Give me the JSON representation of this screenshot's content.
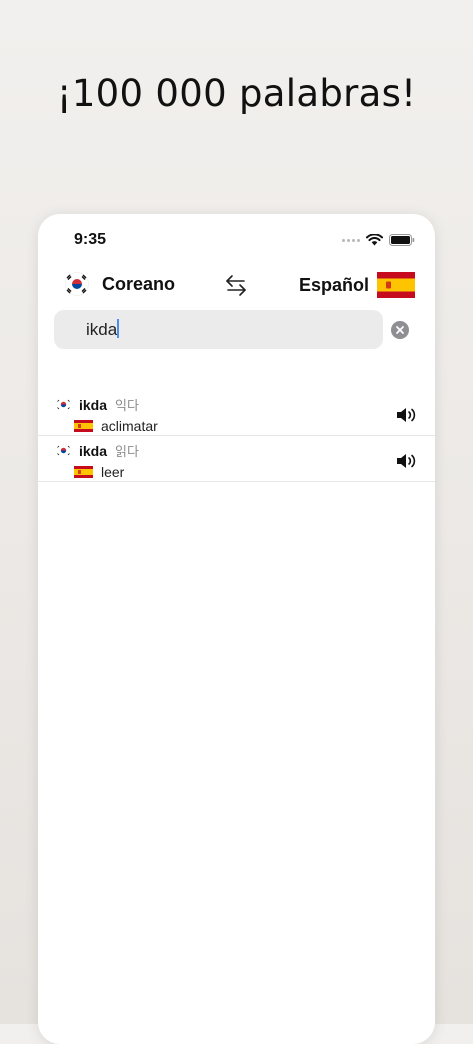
{
  "headline": "¡100 000 palabras!",
  "status_bar": {
    "time": "9:35"
  },
  "languages": {
    "from": {
      "name": "Coreano",
      "flag_icon": "south-korea-flag-icon"
    },
    "to": {
      "name": "Español",
      "flag_icon": "spain-flag-icon"
    },
    "swap_icon": "swap-arrows-icon"
  },
  "search": {
    "value": "ikda",
    "clear_icon": "clear-circle-icon"
  },
  "results": [
    {
      "word": "ikda",
      "hangul": "익다",
      "translation": "aclimatar",
      "audio_icon": "speaker-icon"
    },
    {
      "word": "ikda",
      "hangul": "읽다",
      "translation": "leer",
      "audio_icon": "speaker-icon"
    }
  ],
  "colors": {
    "spain_red": "#c60b1e",
    "spain_yellow": "#ffc400",
    "korea_red": "#cd2e3a",
    "korea_blue": "#0047a0",
    "caret": "#4a8ff0"
  }
}
